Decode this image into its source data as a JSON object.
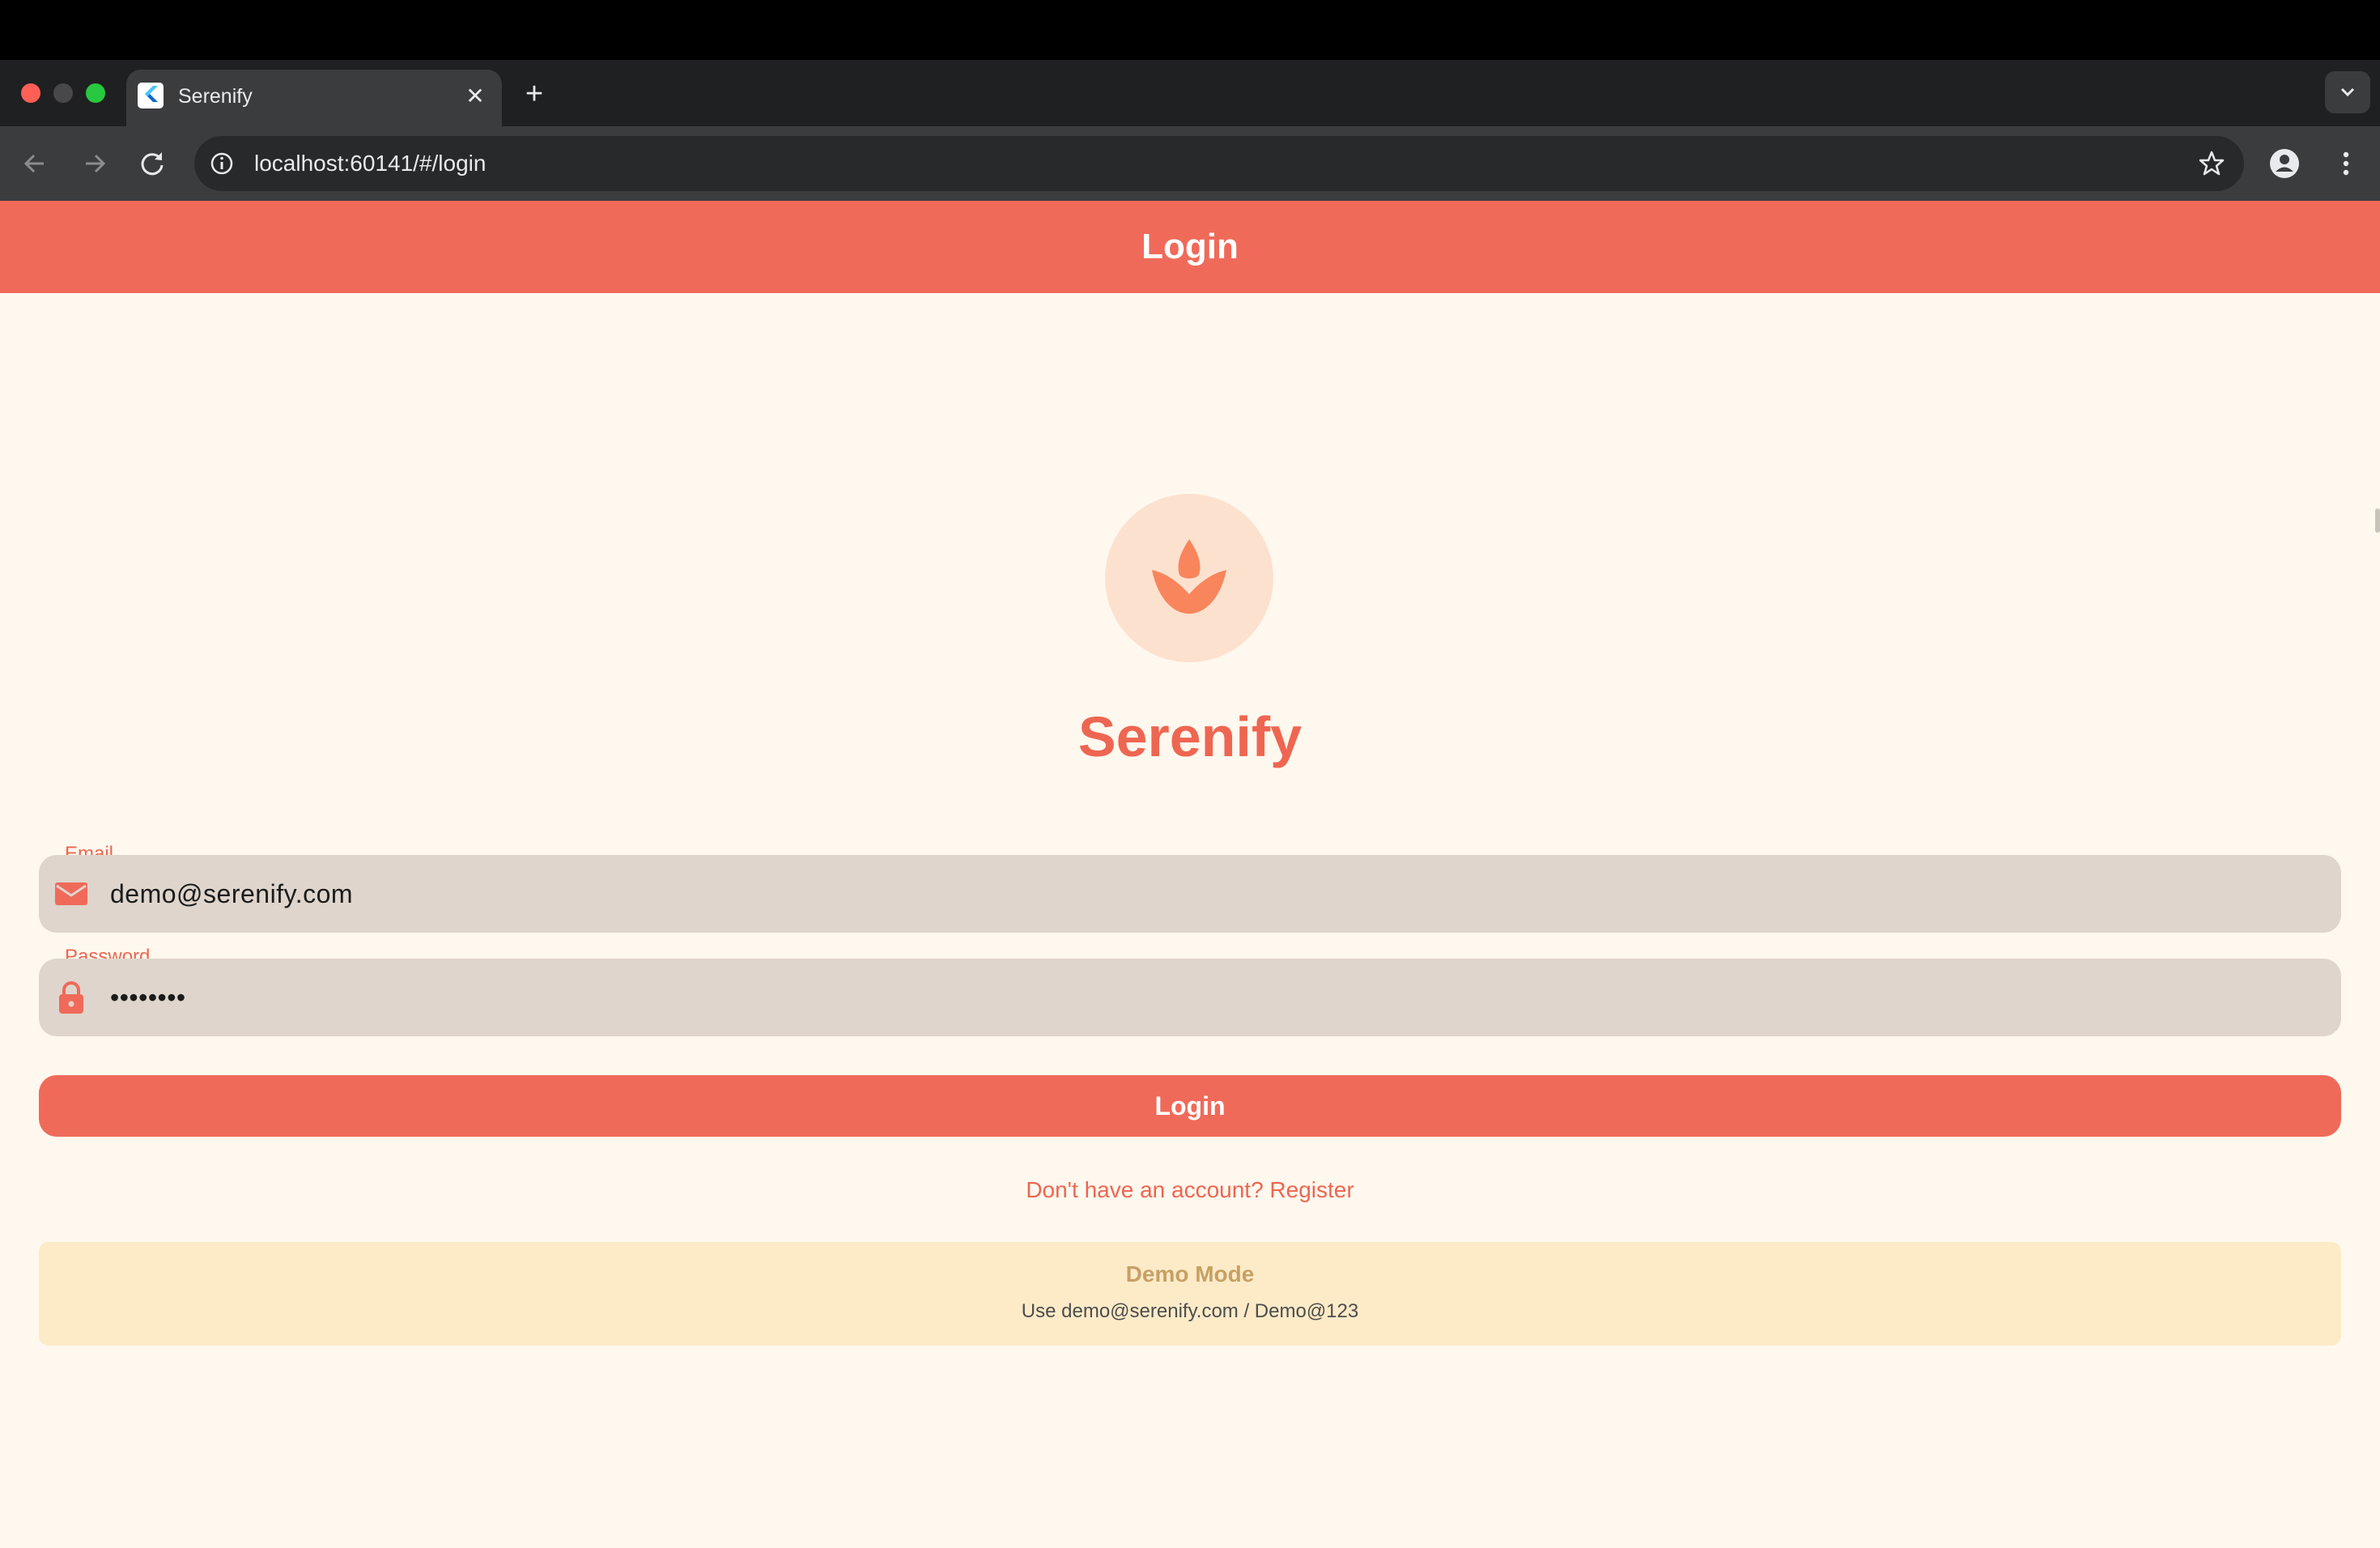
{
  "browser": {
    "tab_title": "Serenify",
    "tab_close": "✕",
    "new_tab": "+",
    "url": "localhost:60141/#/login"
  },
  "appbar": {
    "title": "Login",
    "color": "#f06a5a"
  },
  "brand": {
    "name": "Serenify",
    "logo_icon": "lotus-icon",
    "accent": "#ee6651"
  },
  "form": {
    "email": {
      "label": "Email",
      "value": "demo@serenify.com",
      "icon": "mail-icon"
    },
    "password": {
      "label": "Password",
      "value": "••••••••",
      "icon": "lock-icon"
    },
    "login_button": "Login",
    "register_link": "Don't have an account? Register"
  },
  "demo": {
    "title": "Demo Mode",
    "text": "Use demo@serenify.com / Demo@123"
  }
}
